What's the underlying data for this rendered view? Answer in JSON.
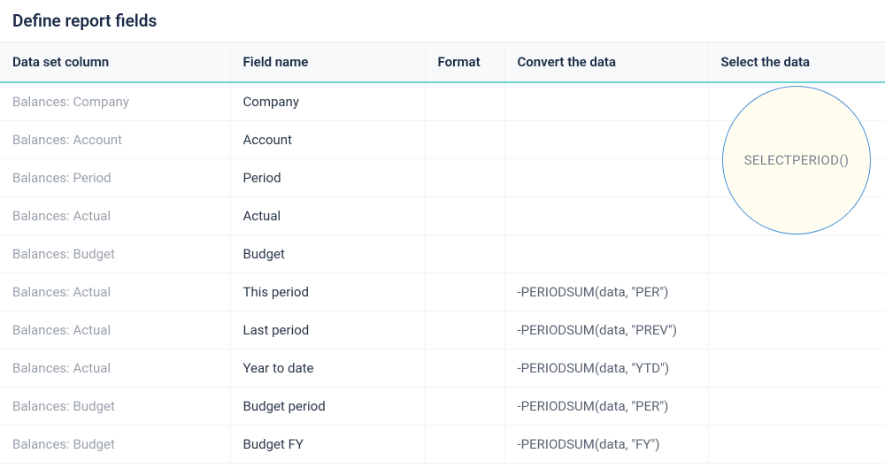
{
  "title": "Define report fields",
  "columns": {
    "dataset": "Data set column",
    "fieldname": "Field name",
    "format": "Format",
    "convert": "Convert the data",
    "select": "Select the data"
  },
  "rows": [
    {
      "dataset": "Balances: Company",
      "fieldname": "Company",
      "format": "",
      "convert": "",
      "select": ""
    },
    {
      "dataset": "Balances: Account",
      "fieldname": "Account",
      "format": "",
      "convert": "",
      "select": ""
    },
    {
      "dataset": "Balances: Period",
      "fieldname": "Period",
      "format": "",
      "convert": "",
      "select": ""
    },
    {
      "dataset": "Balances: Actual",
      "fieldname": "Actual",
      "format": "",
      "convert": "",
      "select": ""
    },
    {
      "dataset": "Balances: Budget",
      "fieldname": "Budget",
      "format": "",
      "convert": "",
      "select": ""
    },
    {
      "dataset": "Balances: Actual",
      "fieldname": "This period",
      "format": "",
      "convert": "-PERIODSUM(data, \"PER\")",
      "select": ""
    },
    {
      "dataset": "Balances: Actual",
      "fieldname": "Last period",
      "format": "",
      "convert": "-PERIODSUM(data, \"PREV\")",
      "select": ""
    },
    {
      "dataset": "Balances: Actual",
      "fieldname": "Year to date",
      "format": "",
      "convert": "-PERIODSUM(data, \"YTD\")",
      "select": ""
    },
    {
      "dataset": "Balances: Budget",
      "fieldname": "Budget period",
      "format": "",
      "convert": "-PERIODSUM(data, \"PER\")",
      "select": ""
    },
    {
      "dataset": "Balances: Budget",
      "fieldname": "Budget FY",
      "format": "",
      "convert": "-PERIODSUM(data, \"FY\")",
      "select": ""
    }
  ],
  "highlight": {
    "text": "SELECTPERIOD()"
  }
}
